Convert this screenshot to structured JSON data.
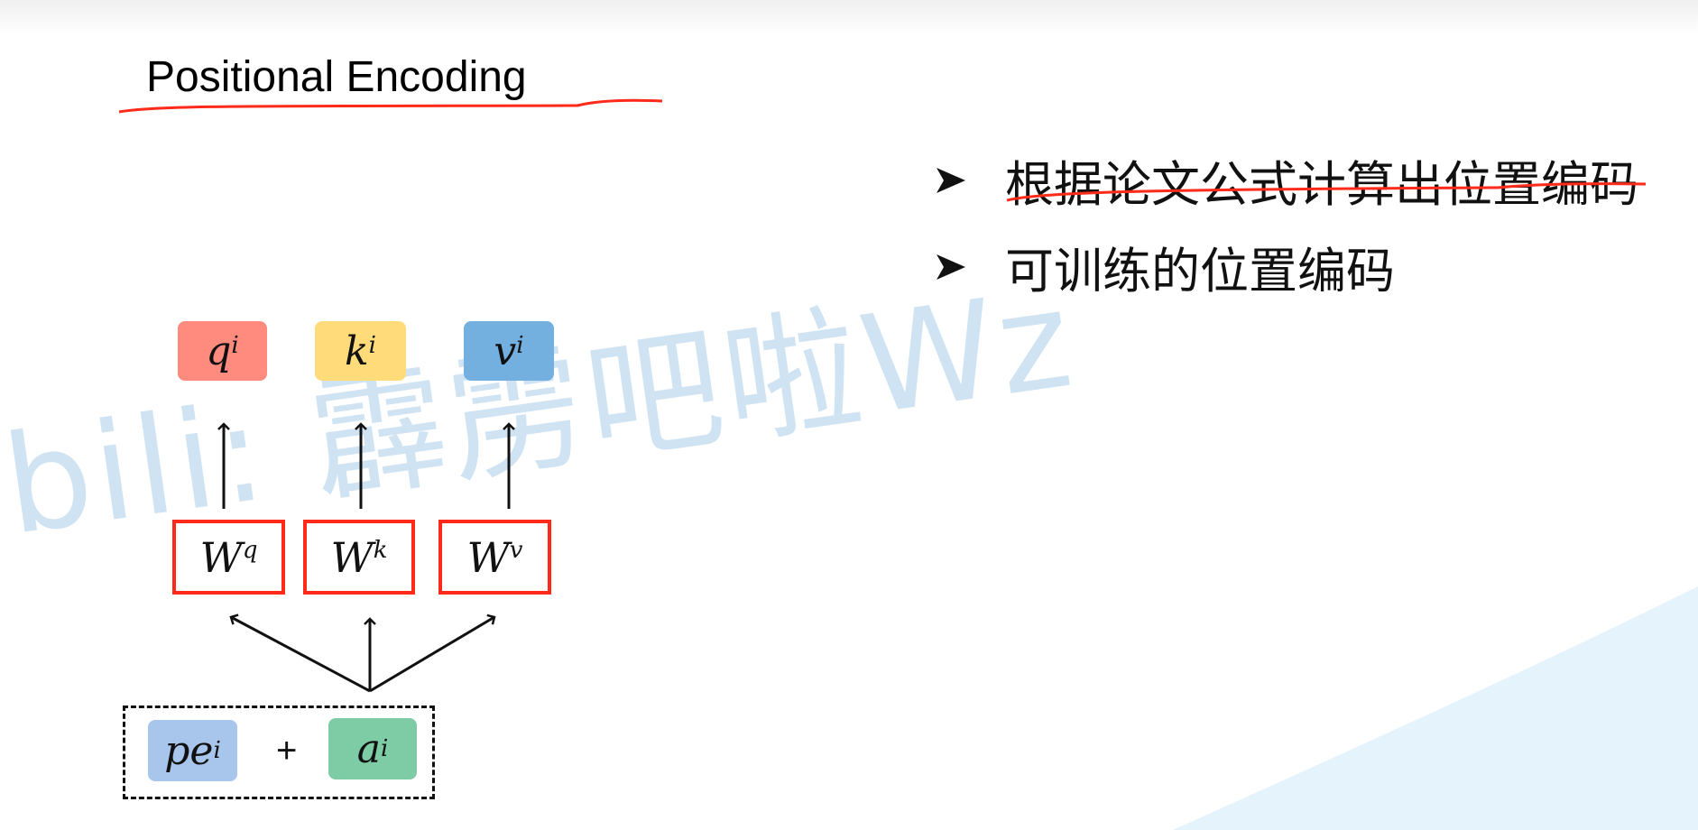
{
  "slide": {
    "title": "Positional Encoding",
    "bullets": [
      {
        "text": "根据论文公式计算出位置编码",
        "icon": "arrowhead-bullet-icon",
        "underlined": true
      },
      {
        "text": "可训练的位置编码",
        "icon": "arrowhead-bullet-icon",
        "underlined": false
      }
    ],
    "watermark": "bili: 霹雳吧啦Wz",
    "diagram": {
      "outputs": [
        {
          "base": "q",
          "sup": "i",
          "color": "#ff8a7e"
        },
        {
          "base": "k",
          "sup": "i",
          "color": "#ffdb7a"
        },
        {
          "base": "v",
          "sup": "i",
          "color": "#73b0e0"
        }
      ],
      "weights": [
        {
          "base": "W",
          "sup": "q"
        },
        {
          "base": "W",
          "sup": "k"
        },
        {
          "base": "W",
          "sup": "v"
        }
      ],
      "input": {
        "pe": {
          "base": "pe",
          "sub": "i",
          "color": "#a8c5ec"
        },
        "op": "+",
        "a": {
          "base": "a",
          "sub": "i",
          "color": "#7dcca6"
        }
      }
    },
    "colors": {
      "annotation_red": "#ff2a1a",
      "weight_border": "#ff2a1a",
      "watermark": "#cfe3f3"
    }
  }
}
